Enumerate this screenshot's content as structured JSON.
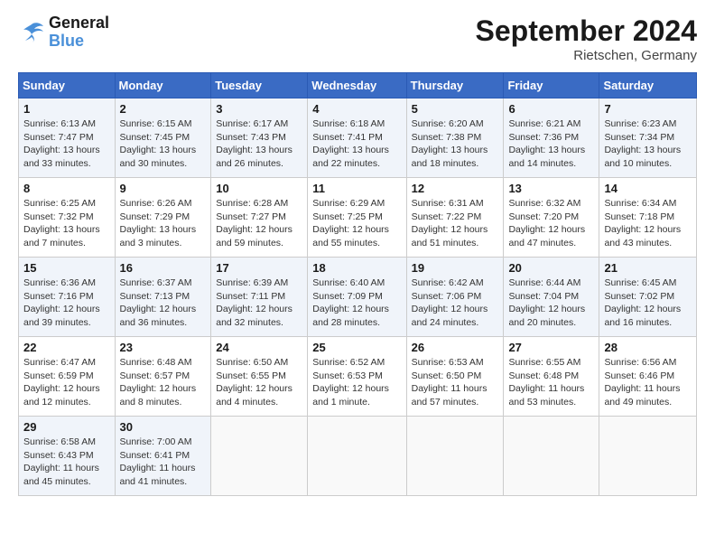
{
  "header": {
    "logo_general": "General",
    "logo_blue": "Blue",
    "month_title": "September 2024",
    "location": "Rietschen, Germany"
  },
  "days_of_week": [
    "Sunday",
    "Monday",
    "Tuesday",
    "Wednesday",
    "Thursday",
    "Friday",
    "Saturday"
  ],
  "weeks": [
    [
      {
        "day": "1",
        "sunrise": "6:13 AM",
        "sunset": "7:47 PM",
        "daylight": "13 hours and 33 minutes."
      },
      {
        "day": "2",
        "sunrise": "6:15 AM",
        "sunset": "7:45 PM",
        "daylight": "13 hours and 30 minutes."
      },
      {
        "day": "3",
        "sunrise": "6:17 AM",
        "sunset": "7:43 PM",
        "daylight": "13 hours and 26 minutes."
      },
      {
        "day": "4",
        "sunrise": "6:18 AM",
        "sunset": "7:41 PM",
        "daylight": "13 hours and 22 minutes."
      },
      {
        "day": "5",
        "sunrise": "6:20 AM",
        "sunset": "7:38 PM",
        "daylight": "13 hours and 18 minutes."
      },
      {
        "day": "6",
        "sunrise": "6:21 AM",
        "sunset": "7:36 PM",
        "daylight": "13 hours and 14 minutes."
      },
      {
        "day": "7",
        "sunrise": "6:23 AM",
        "sunset": "7:34 PM",
        "daylight": "13 hours and 10 minutes."
      }
    ],
    [
      {
        "day": "8",
        "sunrise": "6:25 AM",
        "sunset": "7:32 PM",
        "daylight": "13 hours and 7 minutes."
      },
      {
        "day": "9",
        "sunrise": "6:26 AM",
        "sunset": "7:29 PM",
        "daylight": "13 hours and 3 minutes."
      },
      {
        "day": "10",
        "sunrise": "6:28 AM",
        "sunset": "7:27 PM",
        "daylight": "12 hours and 59 minutes."
      },
      {
        "day": "11",
        "sunrise": "6:29 AM",
        "sunset": "7:25 PM",
        "daylight": "12 hours and 55 minutes."
      },
      {
        "day": "12",
        "sunrise": "6:31 AM",
        "sunset": "7:22 PM",
        "daylight": "12 hours and 51 minutes."
      },
      {
        "day": "13",
        "sunrise": "6:32 AM",
        "sunset": "7:20 PM",
        "daylight": "12 hours and 47 minutes."
      },
      {
        "day": "14",
        "sunrise": "6:34 AM",
        "sunset": "7:18 PM",
        "daylight": "12 hours and 43 minutes."
      }
    ],
    [
      {
        "day": "15",
        "sunrise": "6:36 AM",
        "sunset": "7:16 PM",
        "daylight": "12 hours and 39 minutes."
      },
      {
        "day": "16",
        "sunrise": "6:37 AM",
        "sunset": "7:13 PM",
        "daylight": "12 hours and 36 minutes."
      },
      {
        "day": "17",
        "sunrise": "6:39 AM",
        "sunset": "7:11 PM",
        "daylight": "12 hours and 32 minutes."
      },
      {
        "day": "18",
        "sunrise": "6:40 AM",
        "sunset": "7:09 PM",
        "daylight": "12 hours and 28 minutes."
      },
      {
        "day": "19",
        "sunrise": "6:42 AM",
        "sunset": "7:06 PM",
        "daylight": "12 hours and 24 minutes."
      },
      {
        "day": "20",
        "sunrise": "6:44 AM",
        "sunset": "7:04 PM",
        "daylight": "12 hours and 20 minutes."
      },
      {
        "day": "21",
        "sunrise": "6:45 AM",
        "sunset": "7:02 PM",
        "daylight": "12 hours and 16 minutes."
      }
    ],
    [
      {
        "day": "22",
        "sunrise": "6:47 AM",
        "sunset": "6:59 PM",
        "daylight": "12 hours and 12 minutes."
      },
      {
        "day": "23",
        "sunrise": "6:48 AM",
        "sunset": "6:57 PM",
        "daylight": "12 hours and 8 minutes."
      },
      {
        "day": "24",
        "sunrise": "6:50 AM",
        "sunset": "6:55 PM",
        "daylight": "12 hours and 4 minutes."
      },
      {
        "day": "25",
        "sunrise": "6:52 AM",
        "sunset": "6:53 PM",
        "daylight": "12 hours and 1 minute."
      },
      {
        "day": "26",
        "sunrise": "6:53 AM",
        "sunset": "6:50 PM",
        "daylight": "11 hours and 57 minutes."
      },
      {
        "day": "27",
        "sunrise": "6:55 AM",
        "sunset": "6:48 PM",
        "daylight": "11 hours and 53 minutes."
      },
      {
        "day": "28",
        "sunrise": "6:56 AM",
        "sunset": "6:46 PM",
        "daylight": "11 hours and 49 minutes."
      }
    ],
    [
      {
        "day": "29",
        "sunrise": "6:58 AM",
        "sunset": "6:43 PM",
        "daylight": "11 hours and 45 minutes."
      },
      {
        "day": "30",
        "sunrise": "7:00 AM",
        "sunset": "6:41 PM",
        "daylight": "11 hours and 41 minutes."
      },
      null,
      null,
      null,
      null,
      null
    ]
  ]
}
